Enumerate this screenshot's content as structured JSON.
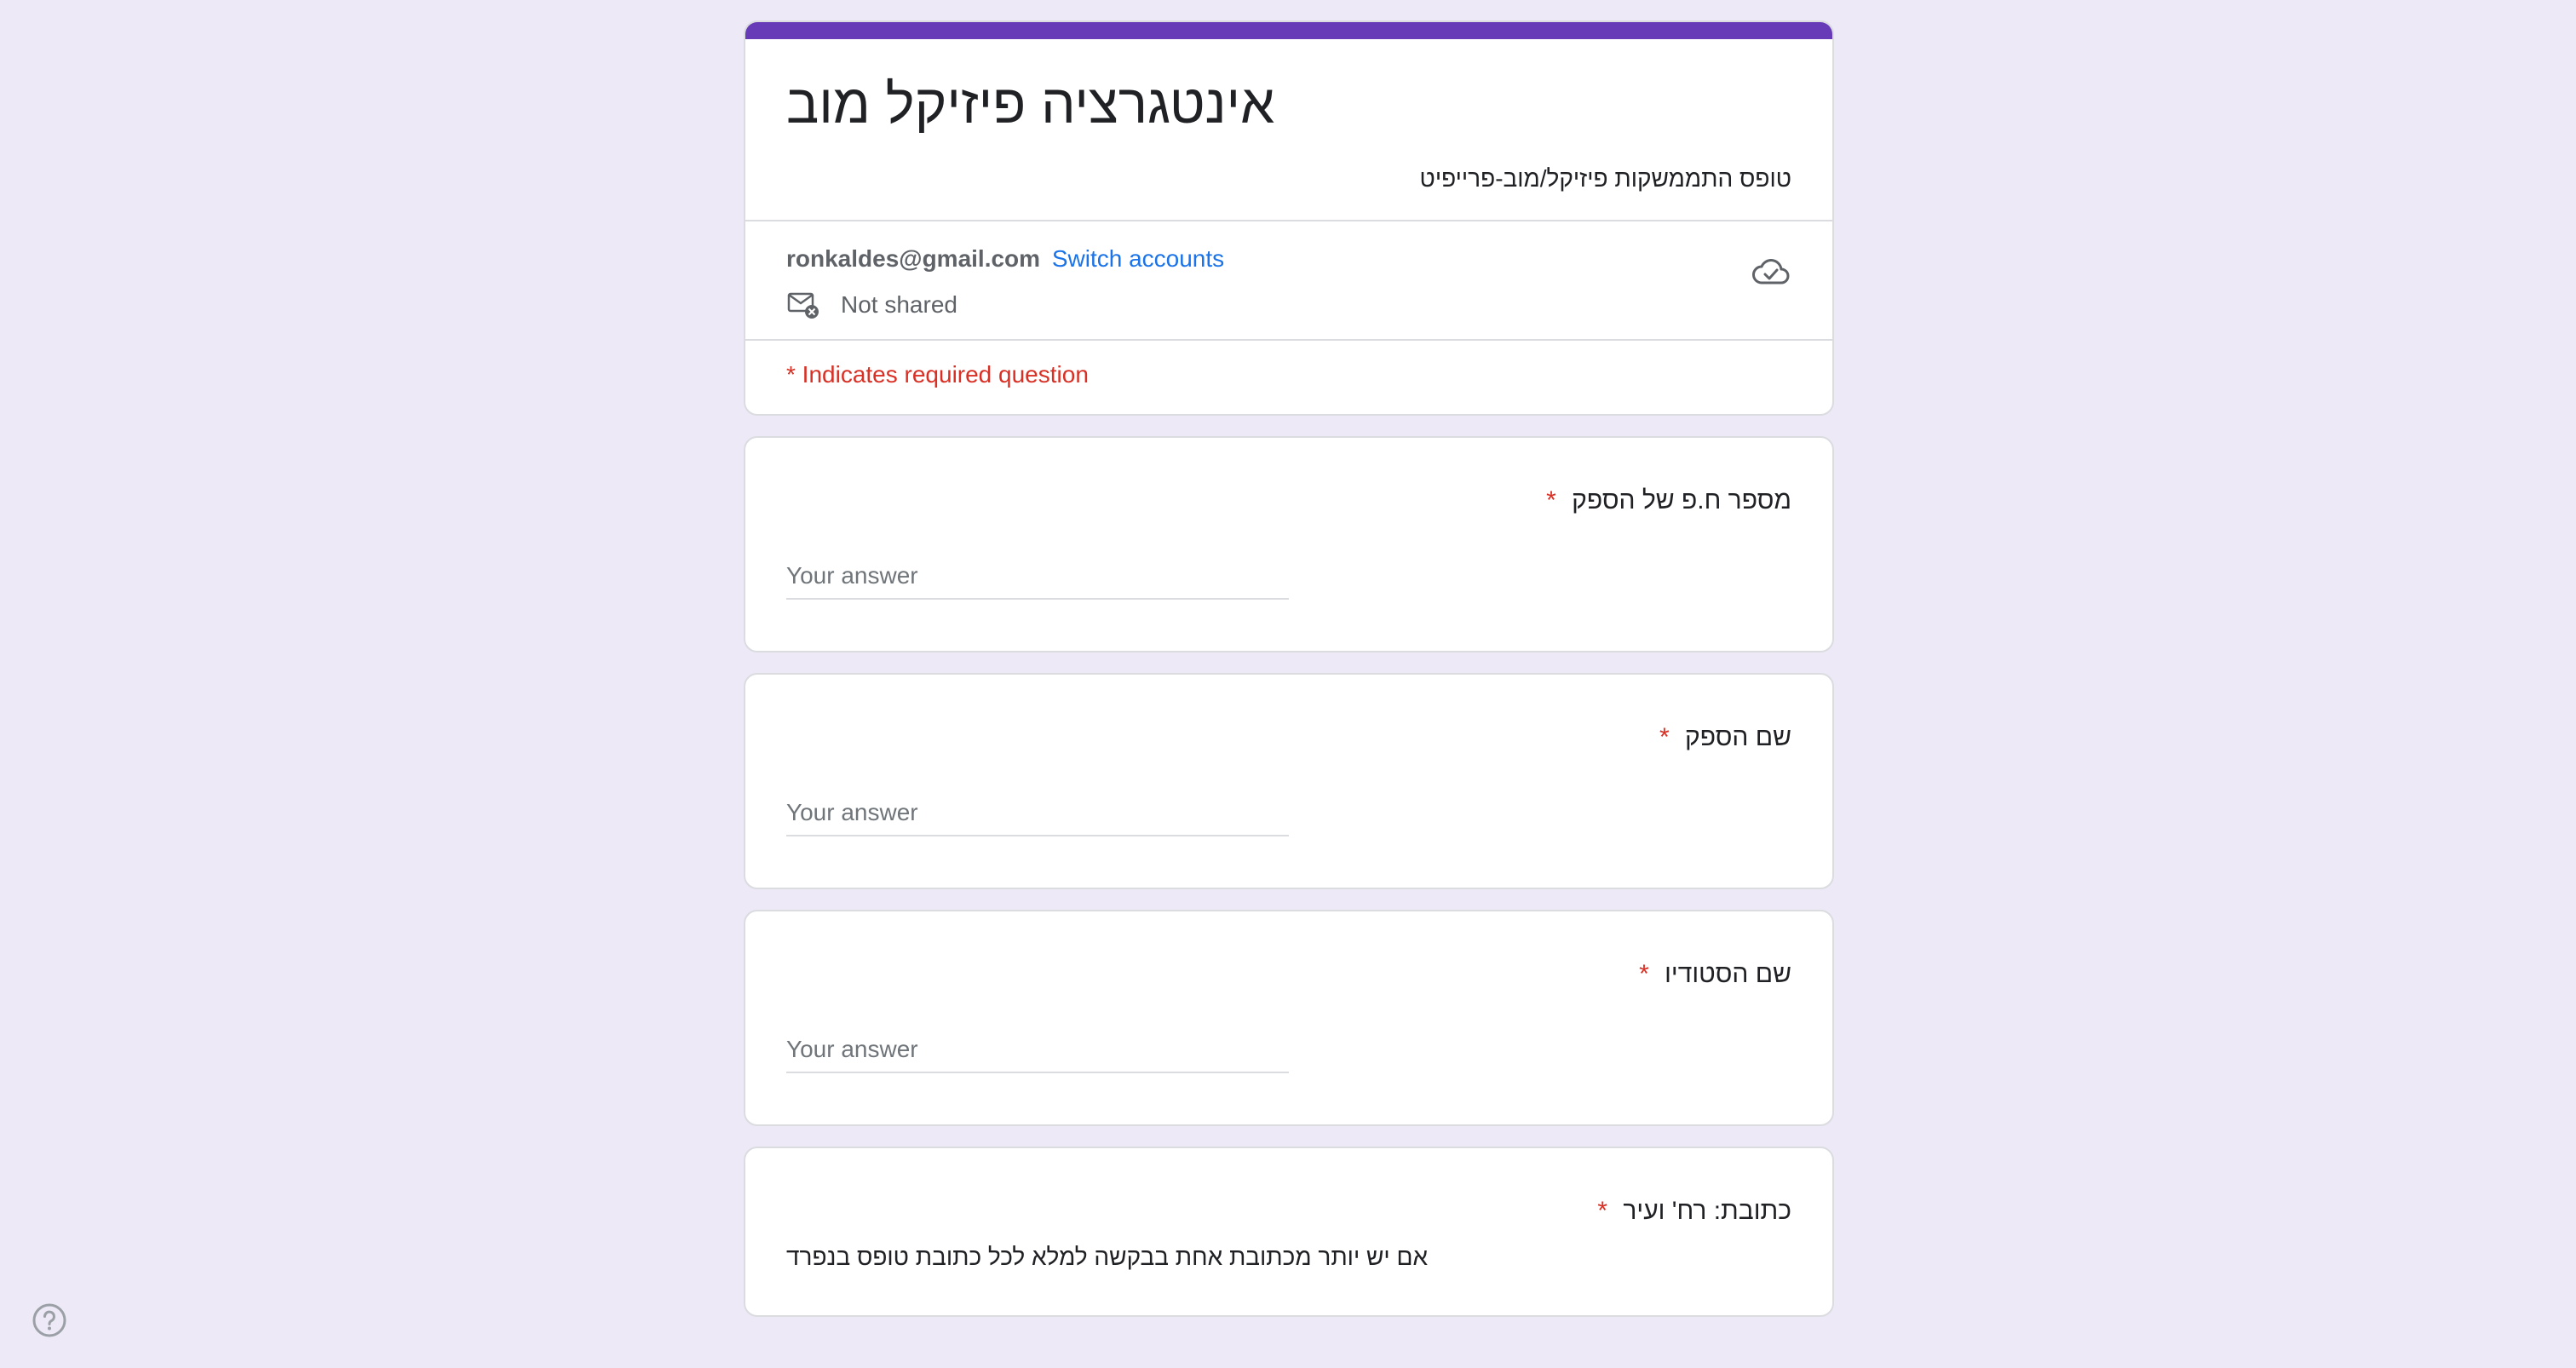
{
  "form": {
    "title": "אינטגרציה פיזיקל מוב",
    "description": "טופס התממשקות פיזיקל/מוב-פרייפיט"
  },
  "account": {
    "email": "ronkaldes@gmail.com",
    "switch_label": "Switch accounts",
    "share_status": "Not shared"
  },
  "required_note": "* Indicates required question",
  "questions": [
    {
      "title": "מספר ח.פ של הספק",
      "required_mark": "*",
      "placeholder": "Your answer"
    },
    {
      "title": "שם הספק",
      "required_mark": "*",
      "placeholder": "Your answer"
    },
    {
      "title": "שם הסטודיו",
      "required_mark": "*",
      "placeholder": "Your answer"
    },
    {
      "title": "כתובת: רח' ועיר",
      "required_mark": "*",
      "help_text": "אם יש יותר מכתובת אחת בבקשה למלא לכל כתובת טופס בנפרד"
    }
  ],
  "colors": {
    "accent": "#673ab7",
    "background": "#ede9f6",
    "required": "#d93025",
    "link": "#1a73e8"
  },
  "icons": {
    "cloud": "cloud-saved-icon",
    "share": "mail-not-shared-icon",
    "help": "help-icon"
  }
}
